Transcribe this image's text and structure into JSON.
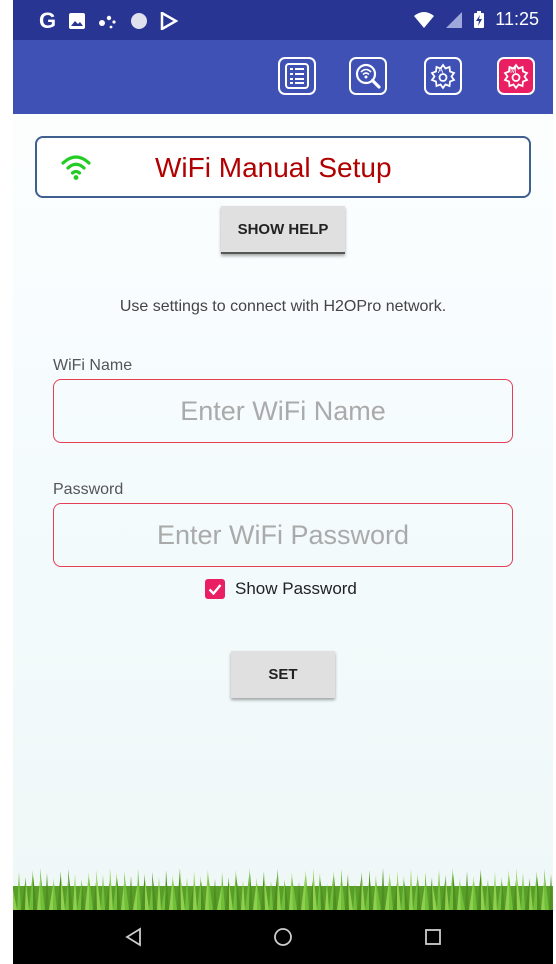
{
  "status_bar": {
    "time": "11:25"
  },
  "toolbar": {
    "buttons": [
      "list-icon",
      "wifi-search-icon",
      "auto-settings-icon",
      "manual-settings-icon"
    ],
    "accent": "#e91e63"
  },
  "header": {
    "title": "WiFi Manual Setup"
  },
  "help": {
    "button_label": "SHOW HELP"
  },
  "info": {
    "text": "Use settings to connect with H2OPro network."
  },
  "wifi_name": {
    "label": "WiFi Name",
    "placeholder": "Enter WiFi Name",
    "value": ""
  },
  "password": {
    "label": "Password",
    "placeholder": "Enter WiFi Password",
    "value": ""
  },
  "show_password": {
    "label": "Show Password",
    "checked": true
  },
  "set": {
    "button_label": "SET"
  },
  "colors": {
    "status_bar": "#283593",
    "toolbar": "#3f51b5",
    "title": "#b00000",
    "field_border": "#e53e55"
  }
}
